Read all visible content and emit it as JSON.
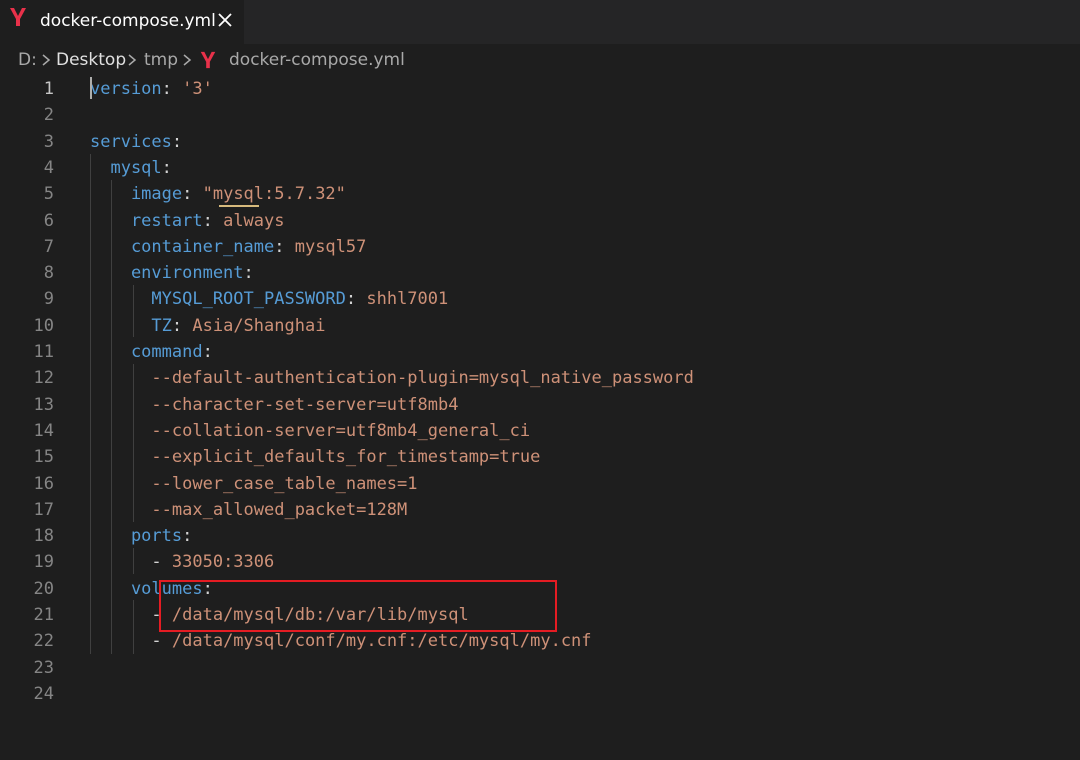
{
  "tab": {
    "label": "docker-compose.yml",
    "file_icon": "yaml-y-icon",
    "close_icon": "close-icon"
  },
  "breadcrumb": {
    "items": [
      "D:",
      "Desktop",
      "tmp",
      "docker-compose.yml"
    ]
  },
  "editor": {
    "lines": [
      {
        "n": "1",
        "tokens": [
          {
            "t": "version",
            "c": "k"
          },
          {
            "t": ": ",
            "c": "p"
          },
          {
            "t": "'3'",
            "c": "s"
          }
        ]
      },
      {
        "n": "2",
        "tokens": []
      },
      {
        "n": "3",
        "tokens": [
          {
            "t": "services",
            "c": "k"
          },
          {
            "t": ":",
            "c": "p"
          }
        ]
      },
      {
        "n": "4",
        "tokens": [
          {
            "t": "  mysql",
            "c": "k"
          },
          {
            "t": ":",
            "c": "p"
          }
        ]
      },
      {
        "n": "5",
        "tokens": [
          {
            "t": "    image",
            "c": "k"
          },
          {
            "t": ": ",
            "c": "p"
          },
          {
            "t": "\"mysql:5.7.32\"",
            "c": "s"
          }
        ]
      },
      {
        "n": "6",
        "tokens": [
          {
            "t": "    restart",
            "c": "k"
          },
          {
            "t": ": ",
            "c": "p"
          },
          {
            "t": "always",
            "c": "s"
          }
        ]
      },
      {
        "n": "7",
        "tokens": [
          {
            "t": "    container_name",
            "c": "k"
          },
          {
            "t": ": ",
            "c": "p"
          },
          {
            "t": "mysql57",
            "c": "s"
          }
        ]
      },
      {
        "n": "8",
        "tokens": [
          {
            "t": "    environment",
            "c": "k"
          },
          {
            "t": ":",
            "c": "p"
          }
        ]
      },
      {
        "n": "9",
        "tokens": [
          {
            "t": "      MYSQL_ROOT_PASSWORD",
            "c": "k"
          },
          {
            "t": ": ",
            "c": "p"
          },
          {
            "t": "shhl7001",
            "c": "s"
          }
        ]
      },
      {
        "n": "10",
        "tokens": [
          {
            "t": "      TZ",
            "c": "k"
          },
          {
            "t": ": ",
            "c": "p"
          },
          {
            "t": "Asia/Shanghai",
            "c": "s"
          }
        ]
      },
      {
        "n": "11",
        "tokens": [
          {
            "t": "    command",
            "c": "k"
          },
          {
            "t": ":",
            "c": "p"
          }
        ]
      },
      {
        "n": "12",
        "tokens": [
          {
            "t": "      --default-authentication-plugin=mysql_native_password",
            "c": "s"
          }
        ]
      },
      {
        "n": "13",
        "tokens": [
          {
            "t": "      --character-set-server=utf8mb4",
            "c": "s"
          }
        ]
      },
      {
        "n": "14",
        "tokens": [
          {
            "t": "      --collation-server=utf8mb4_general_ci",
            "c": "s"
          }
        ]
      },
      {
        "n": "15",
        "tokens": [
          {
            "t": "      --explicit_defaults_for_timestamp=true",
            "c": "s"
          }
        ]
      },
      {
        "n": "16",
        "tokens": [
          {
            "t": "      --lower_case_table_names=1",
            "c": "s"
          }
        ]
      },
      {
        "n": "17",
        "tokens": [
          {
            "t": "      --max_allowed_packet=128M",
            "c": "s"
          }
        ]
      },
      {
        "n": "18",
        "tokens": [
          {
            "t": "    ports",
            "c": "k"
          },
          {
            "t": ":",
            "c": "p"
          }
        ]
      },
      {
        "n": "19",
        "tokens": [
          {
            "t": "      - ",
            "c": "p"
          },
          {
            "t": "33050:3306",
            "c": "s"
          }
        ]
      },
      {
        "n": "20",
        "tokens": [
          {
            "t": "    volumes",
            "c": "k"
          },
          {
            "t": ":",
            "c": "p"
          }
        ]
      },
      {
        "n": "21",
        "tokens": [
          {
            "t": "      - ",
            "c": "p"
          },
          {
            "t": "/data/mysql/db:/var/lib/mysql",
            "c": "s"
          }
        ]
      },
      {
        "n": "22",
        "tokens": [
          {
            "t": "      - ",
            "c": "p"
          },
          {
            "t": "/data/mysql/conf/my.cnf:/etc/mysql/my.cnf",
            "c": "s"
          }
        ]
      },
      {
        "n": "23",
        "tokens": []
      },
      {
        "n": "24",
        "tokens": []
      }
    ]
  },
  "colors": {
    "key": "#569cd6",
    "string": "#ce9178",
    "highlight_box": "#e51c23",
    "yaml_icon": "#e8314a"
  }
}
